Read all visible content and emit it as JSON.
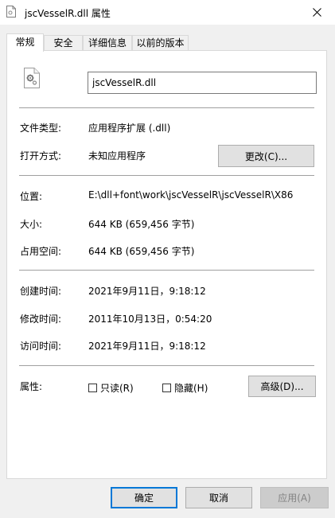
{
  "window": {
    "title": "jscVesselR.dll 属性"
  },
  "tabs": [
    {
      "label": "常规",
      "active": true
    },
    {
      "label": "安全",
      "active": false
    },
    {
      "label": "详细信息",
      "active": false
    },
    {
      "label": "以前的版本",
      "active": false
    }
  ],
  "general": {
    "file_name": "jscVesselR.dll",
    "file_type_label": "文件类型:",
    "file_type_value": "应用程序扩展 (.dll)",
    "open_with_label": "打开方式:",
    "open_with_value": "未知应用程序",
    "change_button": "更改(C)...",
    "location_label": "位置:",
    "location_value": "E:\\dll+font\\work\\jscVesselR\\jscVesselR\\X86",
    "size_label": "大小:",
    "size_value": "644 KB (659,456 字节)",
    "size_on_disk_label": "占用空间:",
    "size_on_disk_value": "644 KB (659,456 字节)",
    "created_label": "创建时间:",
    "created_value": "2021年9月11日，9:18:12",
    "modified_label": "修改时间:",
    "modified_value": "2011年10月13日，0:54:20",
    "accessed_label": "访问时间:",
    "accessed_value": "2021年9月11日，9:18:12",
    "attributes_label": "属性:",
    "readonly_label": "只读(R)",
    "readonly_checked": false,
    "hidden_label": "隐藏(H)",
    "hidden_checked": false,
    "advanced_button": "高级(D)..."
  },
  "footer": {
    "ok_button": "确定",
    "cancel_button": "取消",
    "apply_button": "应用(A)",
    "apply_disabled": true
  },
  "icons": {
    "title": "dll-file-icon",
    "file": "dll-file-gear-icon",
    "close": "close-icon"
  },
  "colors": {
    "accent": "#0078d7",
    "panel_bg": "#ffffff",
    "window_bg": "#f0f0f0"
  }
}
